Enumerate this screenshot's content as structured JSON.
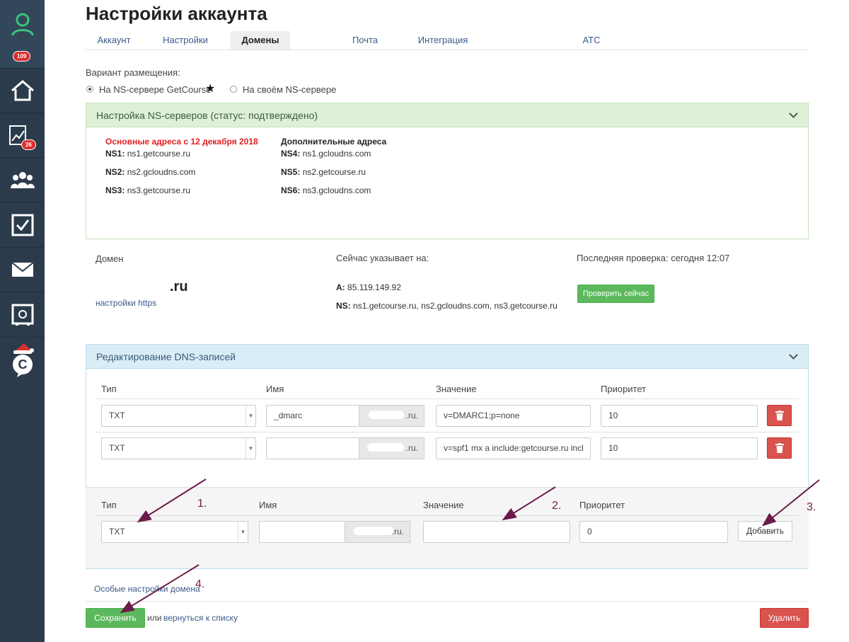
{
  "sidebar": {
    "items": [
      {
        "icon": "user-avatar-icon",
        "badge": "109"
      },
      {
        "icon": "home-icon",
        "badge": ""
      },
      {
        "icon": "stats-chart-icon",
        "badge": "26"
      },
      {
        "icon": "users-group-icon",
        "badge": ""
      },
      {
        "icon": "tasks-checkbox-icon",
        "badge": ""
      },
      {
        "icon": "mail-envelope-icon",
        "badge": ""
      },
      {
        "icon": "safe-icon",
        "badge": ""
      },
      {
        "icon": "getcourse-logo-icon",
        "badge": ""
      }
    ]
  },
  "page": {
    "title": "Настройки аккаунта"
  },
  "tabs": [
    {
      "label": "Аккаунт",
      "active": false
    },
    {
      "label": "Настройки",
      "active": false
    },
    {
      "label": "Домены",
      "active": true
    },
    {
      "label": "Почта",
      "active": false
    },
    {
      "label": "Интеграция",
      "active": false
    },
    {
      "label": "АТС",
      "active": false
    }
  ],
  "hosting": {
    "label": "Вариант размещения:",
    "option1": "На NS-сервере GetCourse",
    "option2": "На своём NS-сервере",
    "selected": "option1"
  },
  "ns_panel": {
    "title": "Настройка NS-серверов (статус: подтверждено)",
    "main_heading": "Основные адреса с 12 декабря 2018",
    "extra_heading": "Дополнительные адреса",
    "main": [
      {
        "key": "NS1:",
        "value": "ns1.getcourse.ru"
      },
      {
        "key": "NS2:",
        "value": "ns2.gcloudns.com"
      },
      {
        "key": "NS3:",
        "value": "ns3.getcourse.ru"
      }
    ],
    "extra": [
      {
        "key": "NS4:",
        "value": "ns1.gcloudns.com"
      },
      {
        "key": "NS5:",
        "value": "ns2.getcourse.ru"
      },
      {
        "key": "NS6:",
        "value": "ns3.gcloudns.com"
      }
    ]
  },
  "domain": {
    "label": "Домен",
    "name": ".ru",
    "https_link": "настройки https",
    "points_label": "Сейчас указывает на:",
    "a_key": "A:",
    "a_value": "85.119.149.92",
    "ns_key": "NS:",
    "ns_value": "ns1.getcourse.ru, ns2.gcloudns.com, ns3.getcourse.ru",
    "last_check": "Последняя проверка: сегодня 12:07",
    "check_button": "Проверить сейчас"
  },
  "dns_panel": {
    "title": "Редактирование DNS-записей",
    "headers": {
      "type": "Тип",
      "name": "Имя",
      "value": "Значение",
      "priority": "Приоритет"
    },
    "records": [
      {
        "type": "TXT",
        "name": "_dmarc",
        "suffix": ".ru.",
        "value": "v=DMARC1;p=none",
        "priority": "10"
      },
      {
        "type": "TXT",
        "name": "",
        "suffix": ".ru.",
        "value": "v=spf1 mx a include:getcourse.ru incl",
        "priority": "10"
      }
    ],
    "new_record": {
      "type": "TXT",
      "name": "",
      "suffix": ".ru.",
      "value": "",
      "priority": "0",
      "add_button": "Добавить"
    }
  },
  "footer": {
    "special_link": "Особые настройки домена",
    "save_button": "Сохранить",
    "or_text": "или",
    "back_link": "вернуться к списку",
    "delete_button": "Удалить"
  },
  "annotations": {
    "a1": "1.",
    "a2": "2.",
    "a3": "3.",
    "a4": "4."
  }
}
